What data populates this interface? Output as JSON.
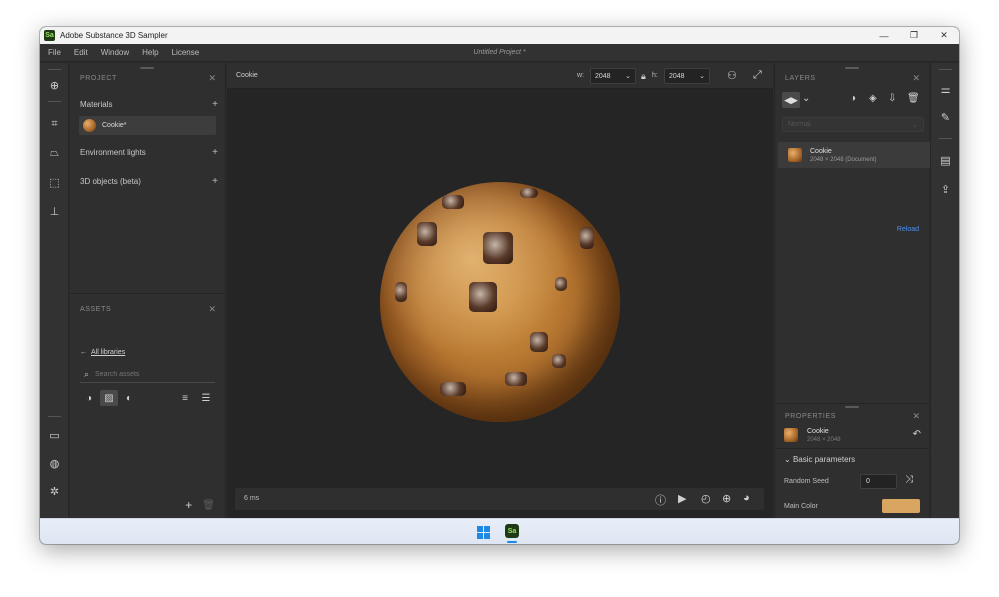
{
  "window": {
    "title": "Adobe Substance 3D Sampler",
    "app_badge": "Sa",
    "controls": {
      "minimize": "—",
      "maximize": "❐",
      "close": "✕"
    }
  },
  "menu": {
    "items": [
      "File",
      "Edit",
      "Window",
      "Help",
      "License"
    ],
    "project_title": "Untitled Project *"
  },
  "project_panel": {
    "header": "PROJECT",
    "materials_label": "Materials",
    "material_item": "Cookie*",
    "environment_label": "Environment lights",
    "objects_label": "3D objects (beta)"
  },
  "assets_panel": {
    "header": "ASSETS",
    "back_label": "All libraries",
    "search_placeholder": "Search assets"
  },
  "viewport": {
    "name": "Cookie",
    "width_label": "w:",
    "width_value": "2048",
    "height_label": "h:",
    "height_value": "2048",
    "render_time": "6 ms"
  },
  "layers_panel": {
    "header": "LAYERS",
    "blend_mode": "Normal",
    "layer_name": "Cookie",
    "layer_meta": "2048 × 2048 (Document)",
    "reload_label": "Reload"
  },
  "properties_panel": {
    "header": "PROPERTIES",
    "item_name": "Cookie",
    "item_meta": "2048 × 2048",
    "section_label": "Basic parameters",
    "seed_label": "Random Seed",
    "seed_value": "0",
    "color_label": "Main Color",
    "main_color": "#d8a661"
  },
  "taskbar": {
    "app_badge": "Sa"
  }
}
